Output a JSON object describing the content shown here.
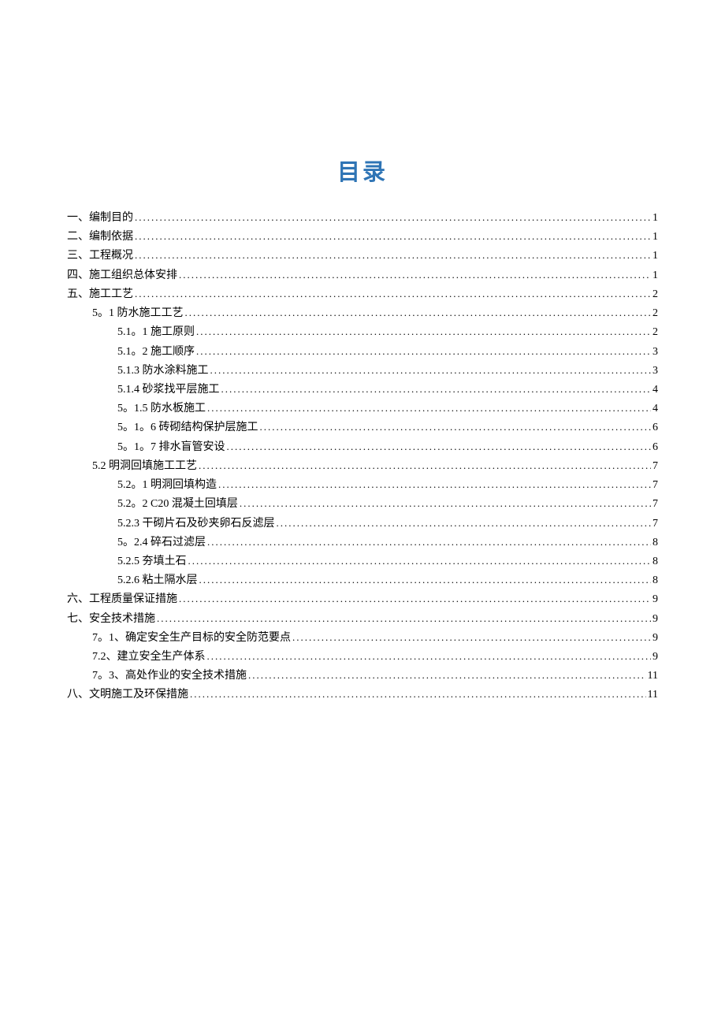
{
  "title": "目录",
  "entries": [
    {
      "level": 1,
      "label": "一、编制目的",
      "page": "1"
    },
    {
      "level": 1,
      "label": "二、编制依据",
      "page": "1"
    },
    {
      "level": 1,
      "label": "三、工程概况",
      "page": "1"
    },
    {
      "level": 1,
      "label": "四、施工组织总体安排",
      "page": "1"
    },
    {
      "level": 1,
      "label": "五、施工工艺",
      "page": "2"
    },
    {
      "level": 2,
      "label": "5。1 防水施工工艺",
      "page": "2"
    },
    {
      "level": 3,
      "label": "5.1。1 施工原则",
      "page": "2"
    },
    {
      "level": 3,
      "label": "5.1。2 施工顺序",
      "page": "3"
    },
    {
      "level": 3,
      "label": "5.1.3 防水涂料施工",
      "page": "3"
    },
    {
      "level": 3,
      "label": "5.1.4 砂浆找平层施工",
      "page": "4"
    },
    {
      "level": 3,
      "label": "5。1.5 防水板施工",
      "page": "4"
    },
    {
      "level": 3,
      "label": "5。1。6 砖砌结构保护层施工",
      "page": "6"
    },
    {
      "level": 3,
      "label": "5。1。7 排水盲管安设",
      "page": "6"
    },
    {
      "level": 2,
      "label": "5.2 明洞回填施工工艺",
      "page": "7"
    },
    {
      "level": 3,
      "label": "5.2。1 明洞回填构造",
      "page": "7"
    },
    {
      "level": 3,
      "label": "5.2。2 C20 混凝土回填层",
      "page": "7"
    },
    {
      "level": 3,
      "label": "5.2.3 干砌片石及砂夹卵石反滤层",
      "page": "7"
    },
    {
      "level": 3,
      "label": "5。2.4 碎石过滤层",
      "page": "8"
    },
    {
      "level": 3,
      "label": "5.2.5 夯填土石",
      "page": "8"
    },
    {
      "level": 3,
      "label": "5.2.6 粘土隔水层",
      "page": "8"
    },
    {
      "level": 1,
      "label": "六、工程质量保证措施",
      "page": "9"
    },
    {
      "level": 1,
      "label": "七、安全技术措施",
      "page": "9"
    },
    {
      "level": 2,
      "label": "7。1、确定安全生产目标的安全防范要点",
      "page": "9"
    },
    {
      "level": 2,
      "label": "7.2、建立安全生产体系",
      "page": "9"
    },
    {
      "level": 2,
      "label": "7。3、高处作业的安全技术措施",
      "page": "11"
    },
    {
      "level": 1,
      "label": "八、文明施工及环保措施",
      "page": "11"
    }
  ]
}
